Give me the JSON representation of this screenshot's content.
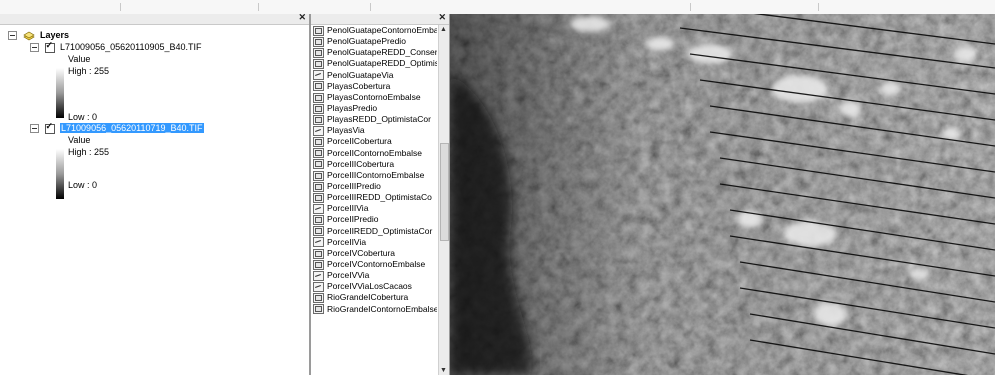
{
  "toc": {
    "root_label": "Layers",
    "layers": [
      {
        "name": "L71009056_05620110905_B40.TIF",
        "checked": true,
        "selected": false,
        "legend_heading": "Value",
        "high_label": "High : 255",
        "low_label": "Low : 0"
      },
      {
        "name": "L71009056_05620110719_B40.TIF",
        "checked": true,
        "selected": true,
        "legend_heading": "Value",
        "high_label": "High : 255",
        "low_label": "Low : 0"
      }
    ]
  },
  "list_panel": {
    "items": [
      {
        "label": "PenolGuatapeContornoEmbalse",
        "icon": "polygon"
      },
      {
        "label": "PenolGuatapePredio",
        "icon": "polygon"
      },
      {
        "label": "PenolGuatapeREDD_Conservacion",
        "icon": "polygon"
      },
      {
        "label": "PenolGuatapeREDD_OptimistaCo",
        "icon": "polygon"
      },
      {
        "label": "PenolGuatapeVia",
        "icon": "polyline"
      },
      {
        "label": "PlayasCobertura",
        "icon": "polygon"
      },
      {
        "label": "PlayasContornoEmbalse",
        "icon": "polygon"
      },
      {
        "label": "PlayasPredio",
        "icon": "polygon"
      },
      {
        "label": "PlayasREDD_OptimistaCor",
        "icon": "polygon"
      },
      {
        "label": "PlayasVia",
        "icon": "polyline"
      },
      {
        "label": "PorceIICobertura",
        "icon": "polygon"
      },
      {
        "label": "PorceIIContornoEmbalse",
        "icon": "polygon"
      },
      {
        "label": "PorceIIICobertura",
        "icon": "polygon"
      },
      {
        "label": "PorceIIIContornoEmbalse",
        "icon": "polygon"
      },
      {
        "label": "PorceIIIPredio",
        "icon": "polygon"
      },
      {
        "label": "PorceIIIREDD_OptimistaCo",
        "icon": "polygon"
      },
      {
        "label": "PorceIIIVia",
        "icon": "polyline"
      },
      {
        "label": "PorceIIPredio",
        "icon": "polygon"
      },
      {
        "label": "PorceIIREDD_OptimistaCor",
        "icon": "polygon"
      },
      {
        "label": "PorceIIVia",
        "icon": "polyline"
      },
      {
        "label": "PorceIVCobertura",
        "icon": "polygon"
      },
      {
        "label": "PorceIVContornoEmbalse",
        "icon": "polygon"
      },
      {
        "label": "PorceIVVia",
        "icon": "polyline"
      },
      {
        "label": "PorceIVViaLosCacaos",
        "icon": "polyline"
      },
      {
        "label": "RioGrandeICobertura",
        "icon": "polygon"
      },
      {
        "label": "RioGrandeIContornoEmbalse",
        "icon": "polygon"
      }
    ]
  },
  "colors": {
    "selection": "#3399ff",
    "map_background": "#3d3d3d"
  }
}
